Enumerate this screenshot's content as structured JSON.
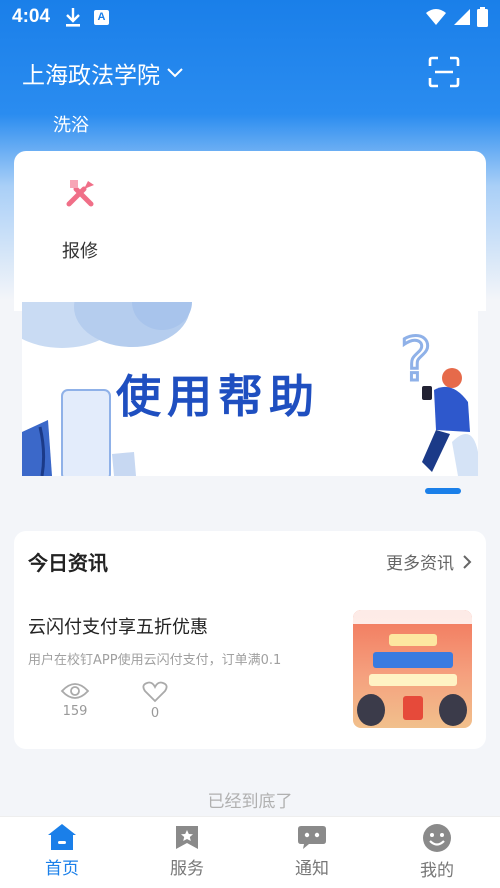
{
  "status_bar": {
    "time": "4:04",
    "notification_badge": "A"
  },
  "header": {
    "campus_name": "上海政法学院"
  },
  "partial_service_label": "洗浴",
  "services": [
    {
      "label": "报修",
      "icon": "wrench-hammer-icon"
    }
  ],
  "banner": {
    "text": "使用帮助"
  },
  "news": {
    "section_title": "今日资讯",
    "more_label": "更多资讯",
    "items": [
      {
        "title": "云闪付支付享五折优惠",
        "summary": "用户在校钉APP使用云闪付支付，订单满0.1",
        "views": "159",
        "likes": "0"
      }
    ]
  },
  "bottom_text": "已经到底了",
  "tabs": [
    {
      "label": "首页",
      "icon": "home-icon",
      "active": true
    },
    {
      "label": "服务",
      "icon": "service-icon",
      "active": false
    },
    {
      "label": "通知",
      "icon": "chat-icon",
      "active": false
    },
    {
      "label": "我的",
      "icon": "smile-icon",
      "active": false
    }
  ],
  "colors": {
    "accent": "#1a7fe9",
    "header_bg": "#1a7fe9",
    "page_bg": "#f3f5f9"
  }
}
